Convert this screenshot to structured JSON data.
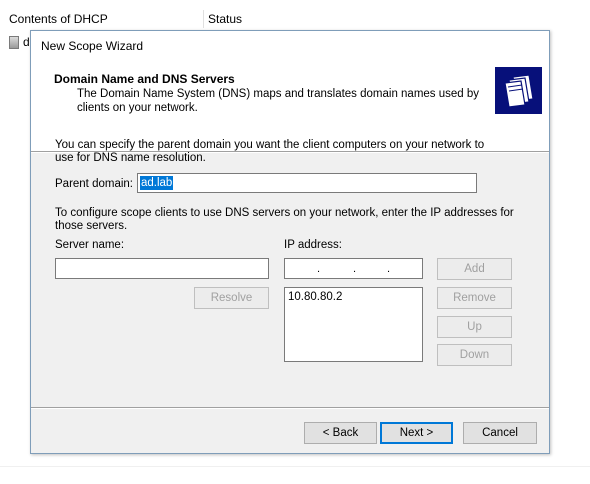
{
  "background": {
    "columns": [
      "Contents of DHCP",
      "Status"
    ],
    "row_text": "d"
  },
  "dialog": {
    "title": "New Scope Wizard",
    "header": {
      "title": "Domain Name and DNS Servers",
      "subtitle": "The Domain Name System (DNS) maps and translates domain names used by clients on your network.",
      "icon": "folders-icon"
    },
    "parent_intro": "You can specify the parent domain you want the client computers on your network to use for DNS name resolution.",
    "parent_domain_label": "Parent domain:",
    "parent_domain_value": "ad.lab",
    "dns_intro": "To configure scope clients to use DNS servers on your network, enter the IP addresses for those servers.",
    "server_name_label": "Server name:",
    "server_name_value": "",
    "ip_address_label": "IP address:",
    "ip_dots": [
      ".",
      ".",
      "."
    ],
    "ip_list": [
      "10.80.80.2"
    ],
    "buttons": {
      "add": "Add",
      "resolve": "Resolve",
      "remove": "Remove",
      "up": "Up",
      "down": "Down",
      "back": "< Back",
      "next": "Next >",
      "cancel": "Cancel"
    }
  },
  "colors": {
    "header_icon_bg": "#07107a",
    "selection": "#0078d7",
    "dialog_bg": "#f0f0f0"
  }
}
